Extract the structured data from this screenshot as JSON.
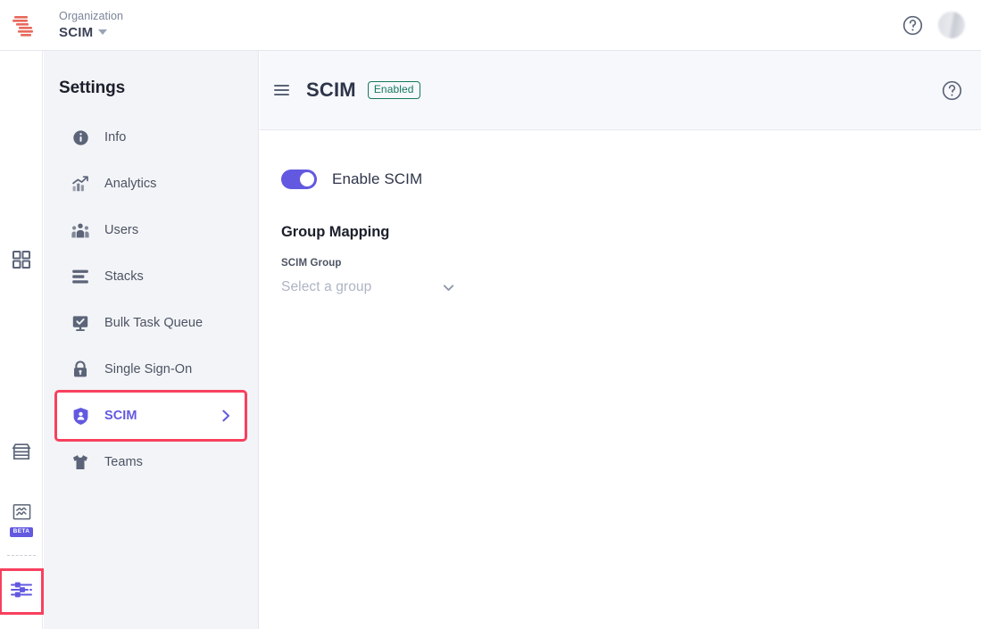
{
  "topbar": {
    "logo_icon": "s-stripes-logo-icon",
    "org_label": "Organization",
    "org_name": "SCIM",
    "caret_icon": "caret-down-icon",
    "help_icon": "help-circle-icon",
    "avatar_icon": "user-avatar"
  },
  "rail": {
    "items": [
      {
        "name": "apps-grid",
        "icon": "grid-icon",
        "label": ""
      },
      {
        "name": "marketplace",
        "icon": "storefront-icon",
        "label": ""
      },
      {
        "name": "integrations",
        "icon": "puzzle-piece-icon",
        "label": "BETA"
      },
      {
        "name": "settings",
        "icon": "sliders-icon",
        "label": ""
      }
    ]
  },
  "sidebar": {
    "title": "Settings",
    "items": [
      {
        "label": "Info",
        "icon": "info-circle-icon",
        "active": false
      },
      {
        "label": "Analytics",
        "icon": "bar-chart-icon",
        "active": false
      },
      {
        "label": "Users",
        "icon": "users-group-icon",
        "active": false
      },
      {
        "label": "Stacks",
        "icon": "stacks-icon",
        "active": false
      },
      {
        "label": "Bulk Task Queue",
        "icon": "task-queue-icon",
        "active": false
      },
      {
        "label": "Single Sign-On",
        "icon": "lock-icon",
        "active": false
      },
      {
        "label": "SCIM",
        "icon": "shield-user-icon",
        "active": true
      },
      {
        "label": "Teams",
        "icon": "tshirt-icon",
        "active": false
      }
    ],
    "chevron_icon": "chevron-right-icon"
  },
  "main": {
    "menu_icon": "hamburger-menu-icon",
    "title": "SCIM",
    "status_badge": "Enabled",
    "help_icon": "help-circle-icon",
    "toggle": {
      "label": "Enable SCIM",
      "state": "on"
    },
    "group_mapping": {
      "section_title": "Group Mapping",
      "field_label": "SCIM Group",
      "select_placeholder": "Select a group",
      "select_value": "",
      "chevron_icon": "chevron-down-icon"
    }
  },
  "colors": {
    "accent_purple": "#6259e0",
    "highlight_red": "#f8405e",
    "status_green": "#137a5e",
    "logo_red": "#e8695c",
    "icon_slate": "#5b6478"
  }
}
